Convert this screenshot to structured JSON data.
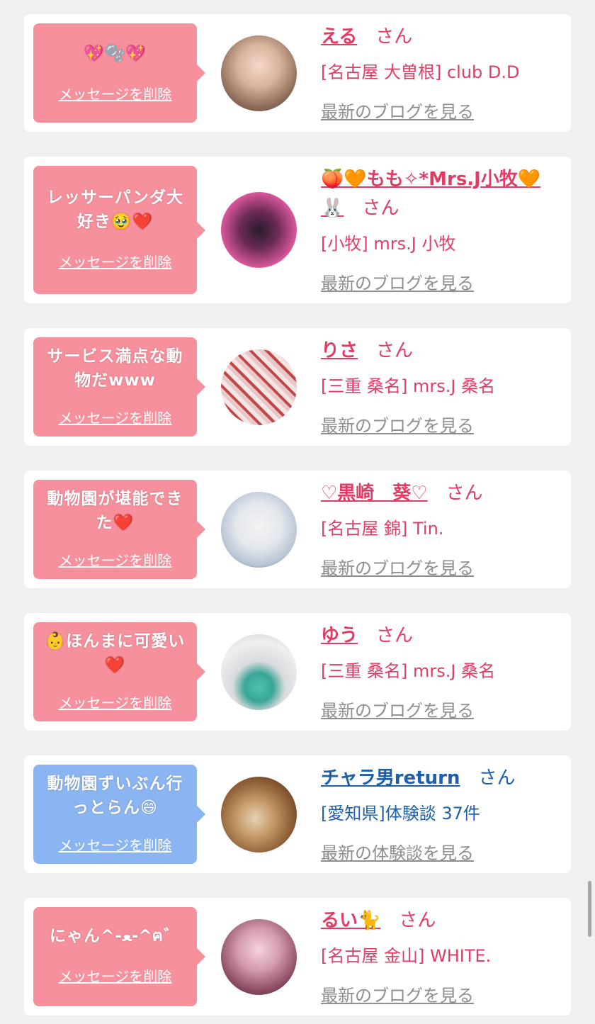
{
  "cards": [
    {
      "message": "💖🫧💖",
      "delete_label": "メッセージを削除",
      "name": "える",
      "honorific": "さん",
      "shop": "[名古屋 大曽根] club D.D",
      "link": "最新のブログを見る",
      "bubble_color": "#f7909d"
    },
    {
      "message": "レッサーパンダ大好き🥹❤️",
      "delete_label": "メッセージを削除",
      "name": "🍑🧡もも✧*Mrs.J小牧🧡🐰",
      "honorific": "さん",
      "shop": "[小牧] mrs.J 小牧",
      "link": "最新のブログを見る",
      "bubble_color": "#f7909d"
    },
    {
      "message": "サービス満点な動物だwww",
      "delete_label": "メッセージを削除",
      "name": "りさ",
      "honorific": "さん",
      "shop": "[三重 桑名] mrs.J 桑名",
      "link": "最新のブログを見る",
      "bubble_color": "#f7909d"
    },
    {
      "message": "動物園が堪能できた❤️",
      "delete_label": "メッセージを削除",
      "name": "♡黒崎　葵♡",
      "honorific": "さん",
      "shop": "[名古屋 錦] Tin.",
      "link": "最新のブログを見る",
      "bubble_color": "#f7909d"
    },
    {
      "message": "👶ほんまに可愛い❤️",
      "delete_label": "メッセージを削除",
      "name": "ゆう",
      "honorific": "さん",
      "shop": "[三重 桑名] mrs.J 桑名",
      "link": "最新のブログを見る",
      "bubble_color": "#f7909d"
    },
    {
      "message": "動物園ずいぶん行っとらん😄",
      "delete_label": "メッセージを削除",
      "name": "チャラ男return",
      "honorific": "さん",
      "shop": "[愛知県]体験談 37件",
      "link": "最新の体験談を見る",
      "bubble_color": "#8bb4f2"
    },
    {
      "message": "にゃん^-ﻌ-^ฅ゛",
      "delete_label": "メッセージを削除",
      "name": "るい🐈",
      "honorific": "さん",
      "shop": "[名古屋 金山] WHITE.",
      "link": "最新のブログを見る",
      "bubble_color": "#f7909d"
    }
  ]
}
